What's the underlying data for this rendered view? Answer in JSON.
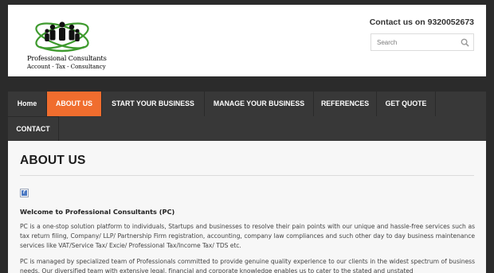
{
  "header": {
    "logo": {
      "name": "Professional Consultants",
      "tagline": "Account - Tax - Consultancy"
    },
    "contact": "Contact us on 9320052673",
    "search": {
      "placeholder": "Search"
    }
  },
  "nav": {
    "items": [
      {
        "label": "Home",
        "active": false
      },
      {
        "label": "ABOUT US",
        "active": true
      },
      {
        "label": "START YOUR BUSINESS",
        "active": false
      },
      {
        "label": "MANAGE YOUR BUSINESS",
        "active": false
      },
      {
        "label": "REFERENCES",
        "active": false
      },
      {
        "label": "GET QUOTE",
        "active": false
      },
      {
        "label": "CONTACT",
        "active": false
      }
    ],
    "active_color": "#f06d2e"
  },
  "content": {
    "title": "ABOUT US",
    "welcome": "Welcome to Professional Consultants (PC)",
    "paragraphs": [
      "PC is a one-stop solution platform to individuals, Startups and businesses to resolve their pain points with our unique and hassle-free services such as tax return filing, Company/ LLP/ Partnership Firm registration, accounting, company law compliances and such other day to day business maintenance services like VAT/Service Tax/ Excie/ Professional Tax/Income Tax/ TDS etc.",
      "PC is managed by specialized team of Professionals committed to provide genuine quality experience to our clients in the widest spectrum of business needs. Our diversified team with extensive legal, financial and corporate knowledge enables us to cater to the stated and unstated"
    ]
  }
}
